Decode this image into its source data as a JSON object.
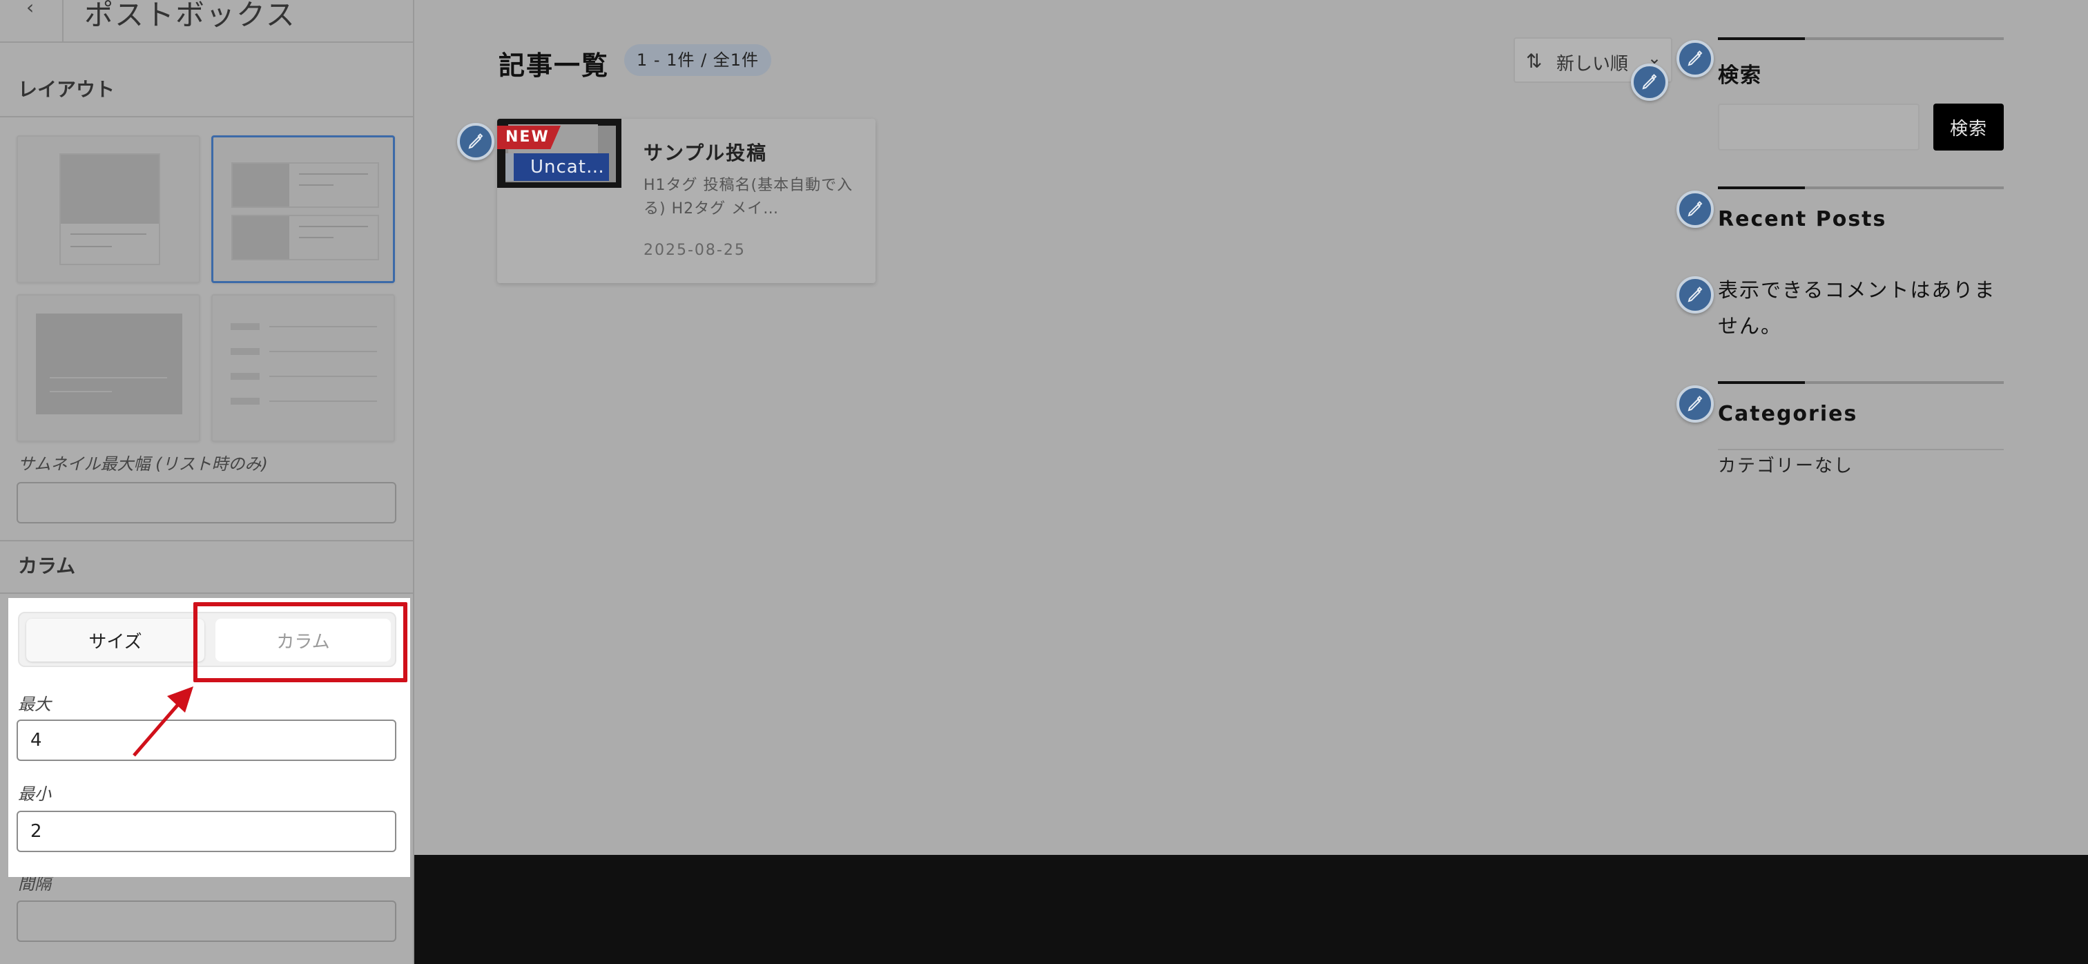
{
  "sidebar": {
    "title": "ポストボックス",
    "layout_section": "レイアウト",
    "thumbnail_label": "サムネイル最大幅 (リスト時のみ)",
    "thumbnail_value": "",
    "column_section": "カラム",
    "toggle": {
      "size_label": "サイズ",
      "column_label": "カラム",
      "active": "サイズ"
    },
    "max_label": "最大",
    "max_value": "4",
    "min_label": "最小",
    "min_value": "2",
    "gap_label": "間隔",
    "gap_value": ""
  },
  "main": {
    "title": "記事一覧",
    "count": "1 - 1件 / 全1件",
    "sort_label": "新しい順",
    "post": {
      "new_tag": "NEW",
      "category": "Uncat…",
      "title": "サンプル投稿",
      "excerpt": "H1タグ 投稿名(基本自動で入る) H2タグ メイ…",
      "date": "2025-08-25"
    }
  },
  "widgets": {
    "search_title": "検索",
    "search_button": "検索",
    "search_value": "",
    "recent_title": "Recent Posts",
    "no_comments": "表示できるコメントはありません。",
    "categories_title": "Categories",
    "no_categories": "カテゴリーなし"
  },
  "colors": {
    "highlight": "#d0101a",
    "pin": "#3e6696",
    "category_chip": "#23448f",
    "new_tag": "#c0242a"
  }
}
